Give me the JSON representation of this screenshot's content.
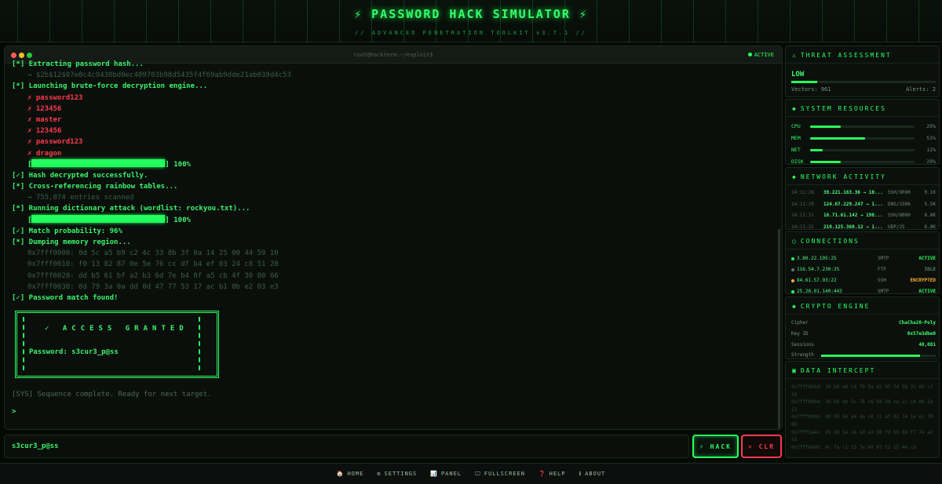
{
  "header": {
    "title": "⚡ PASSWORD HACK SIMULATOR ⚡",
    "subtitle": "// ADVANCED PENETRATION TOOLKIT v3.7.1 //"
  },
  "terminal": {
    "path": "root@hackterm:~/exploit$",
    "status": "ACTIVE",
    "lines": [
      {
        "text": "[*] Extracting password hash...",
        "style": "normal",
        "indent": false
      },
      {
        "text": "→ $2b$12$07e0c4c9430bd0ec409703b98d5435f4f69ab9dde21ab039d4c53",
        "style": "dim",
        "indent": true
      },
      {
        "text": "[*] Launching brute-force decryption engine...",
        "style": "normal",
        "indent": false
      },
      {
        "text": "✗ password123",
        "style": "red",
        "indent": true
      },
      {
        "text": "✗ 123456",
        "style": "red",
        "indent": true
      },
      {
        "text": "✗ master",
        "style": "red",
        "indent": true
      },
      {
        "text": "✗ 123456",
        "style": "red",
        "indent": true
      },
      {
        "text": "✗ password123",
        "style": "red",
        "indent": true
      },
      {
        "text": "✗ dragon",
        "style": "red",
        "indent": true
      },
      {
        "text": "100%",
        "style": "progress",
        "indent": true,
        "progress": 1.0
      },
      {
        "text": "[✓] Hash decrypted successfully.",
        "style": "normal",
        "indent": false
      },
      {
        "text": "[*] Cross-referencing rainbow tables...",
        "style": "normal",
        "indent": false
      },
      {
        "text": "→ 755,074 entries scanned",
        "style": "dim",
        "indent": true
      },
      {
        "text": "[*] Running dictionary attack (wordlist: rockyou.txt)...",
        "style": "normal",
        "indent": false
      },
      {
        "text": "100%",
        "style": "progress",
        "indent": true,
        "progress": 1.0
      },
      {
        "text": "[✓] Match probability: 96%",
        "style": "normal",
        "indent": false
      },
      {
        "text": "[*] Dumping memory region...",
        "style": "normal",
        "indent": false
      },
      {
        "text": "0x7fff0000: 0d 5c a5 b9 c2 4c 33 8b 3f 0a 14 25 00 44 59 10",
        "style": "dim",
        "indent": true
      },
      {
        "text": "0x7fff0010: f0 13 82 87 0e 5e 76 cc df b4 ef 03 24 c8 51 20",
        "style": "dim",
        "indent": true
      },
      {
        "text": "0x7fff0020: dd b5 61 bf a2 b3 6d 7e b4 0f a5 cb 4f 30 80 66",
        "style": "dim",
        "indent": true
      },
      {
        "text": "0x7fff0030: 8d 79 3a 0a dd 0d 47 77 53 17 ac b1 0b e2 03 e3",
        "style": "dim",
        "indent": true
      },
      {
        "text": "[✓] Password match found!",
        "style": "normal",
        "indent": false
      }
    ],
    "granted_title": "✓ ACCESS GRANTED",
    "granted_password": "Password: s3cur3_p@ss",
    "sys_line": "[SYS] Sequence complete. Ready for next target.",
    "prompt": ">"
  },
  "input": {
    "value": "s3cur3_p@ss"
  },
  "buttons": {
    "hack": "⚡ HACK",
    "clear": "✕ CLR"
  },
  "footer": {
    "items": [
      {
        "icon": "🏠",
        "label": "HOME"
      },
      {
        "icon": "⚙",
        "label": "SETTINGS"
      },
      {
        "icon": "📊",
        "label": "PANEL"
      },
      {
        "icon": "🖵",
        "label": "FULLSCREEN"
      },
      {
        "icon": "❓",
        "label": "HELP"
      },
      {
        "icon": "ℹ",
        "label": "ABOUT"
      }
    ]
  },
  "threat": {
    "title": "THREAT ASSESSMENT",
    "icon": "⚠",
    "level": "LOW",
    "level_fraction": 0.18,
    "vectors": "Vectors: 961",
    "alerts": "Alerts: 2"
  },
  "resources": {
    "title": "SYSTEM RESOURCES",
    "icon": "◆",
    "items": [
      {
        "label": "CPU",
        "value": 29,
        "text": "29%"
      },
      {
        "label": "MEM",
        "value": 53,
        "text": "53%"
      },
      {
        "label": "NET",
        "value": 12,
        "text": "12%"
      },
      {
        "label": "DISK",
        "value": 29,
        "text": "29%"
      }
    ]
  },
  "network": {
    "title": "NETWORK ACTIVITY",
    "icon": "◆",
    "rows": [
      {
        "time": "14:11:28",
        "addr": "38.221.163.36 → 10...",
        "proto": "SSH/9090",
        "size": "0.1K"
      },
      {
        "time": "14:11:29",
        "addr": "124.67.229.247 → 1...",
        "proto": "DNS/3306",
        "size": "5.5K"
      },
      {
        "time": "14:11:31",
        "addr": "16.71.61.142 → 198...",
        "proto": "SSH/8080",
        "size": "8.8K"
      },
      {
        "time": "14:11:32",
        "addr": "210.125.368.12 → 1...",
        "proto": "UDP/25",
        "size": "6.8K"
      }
    ]
  },
  "connections": {
    "title": "CONNECTIONS",
    "icon": "○",
    "rows": [
      {
        "ip": "3.80.22.195:25",
        "proto": "SMTP",
        "status": "ACTIVE",
        "color": "#2aff5c"
      },
      {
        "ip": "116.54.7.230:25",
        "proto": "FTP",
        "status": "IDLE",
        "color": "#5f7a69"
      },
      {
        "ip": "84.61.57.93:22",
        "proto": "SSH",
        "status": "ENCRYPTED",
        "color": "#ffb02e"
      },
      {
        "ip": "25.26.91.140:443",
        "proto": "SMTP",
        "status": "ACTIVE",
        "color": "#2aff5c"
      }
    ]
  },
  "crypto": {
    "title": "CRYPTO ENGINE",
    "icon": "◆",
    "cipher_label": "Cipher",
    "cipher": "ChaCha20-Poly",
    "key_label": "Key ID",
    "key": "0x57e3dbe0",
    "sessions_label": "Sessions",
    "sessions": "48,081",
    "strength_label": "Strength",
    "strength": 0.86
  },
  "intercept": {
    "title": "DATA INTERCEPT",
    "icon": "▣",
    "lines": [
      "0x7fff066d: 20 b0 e0 c4 79 5a d2 0f 74 5b 2c 09 c1 10",
      "0x7fff0b68: 3b 66 eb 5c 76 c6 94 58 ca 2c 1b 0b 5a 13",
      "0x7fff0030: d0 99 84 a4 4a c0 11 af 02 74 1e ec 70 6b",
      "0x7fff1e4c: 85 e8 5e 18 10 a3 38 f2 60 0d f7 74 a2 51",
      "0x7fff0ad0: 4c fa c1 23 7a 60 07 52 15 44 cb"
    ]
  }
}
